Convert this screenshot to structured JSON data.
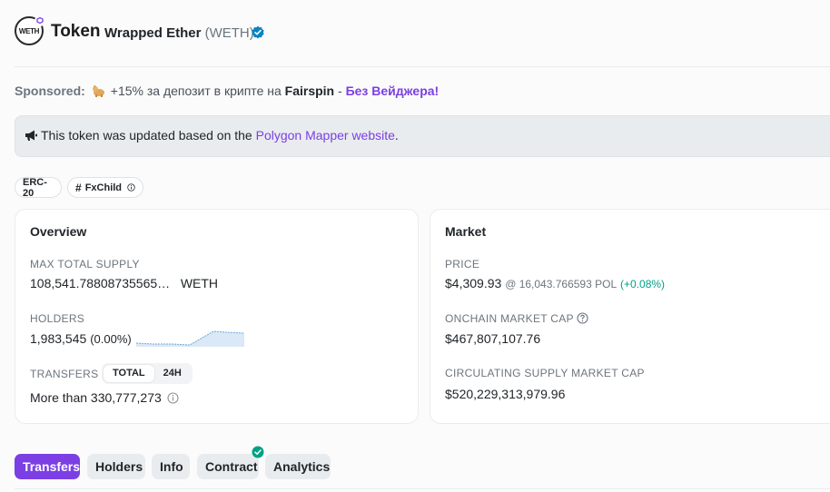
{
  "header": {
    "logo_text": "WETH",
    "title": "Token",
    "token_name": "Wrapped Ether",
    "token_symbol": "(WETH)"
  },
  "sponsored": {
    "label": "Sponsored:",
    "text": "+15% за депозит в крипте на ",
    "brand": "Fairspin",
    "sep": " - ",
    "cta": "Без Вейджера!"
  },
  "alert": {
    "text": "This token was updated based on the ",
    "link": "Polygon Mapper website",
    "end": "."
  },
  "tags": {
    "erc": "ERC-20",
    "fxchild": "FxChild"
  },
  "overview": {
    "title": "Overview",
    "max_supply_label": "MAX TOTAL SUPPLY",
    "max_supply_value": "108,541.78808735565…",
    "max_supply_unit": "WETH",
    "holders_label": "HOLDERS",
    "holders_value": "1,983,545",
    "holders_pct": "(0.00%)",
    "transfers_label": "TRANSFERS",
    "seg_total": "TOTAL",
    "seg_24h": "24H",
    "transfers_value": "More than 330,777,273"
  },
  "market": {
    "title": "Market",
    "price_label": "PRICE",
    "price_value": "$4,309.93",
    "price_pol": "@ 16,043.766593 POL",
    "price_change": "(+0.08%)",
    "onchain_label": "ONCHAIN MARKET CAP",
    "onchain_value": "$467,807,107.76",
    "circ_label": "CIRCULATING SUPPLY MARKET CAP",
    "circ_value": "$520,229,313,979.96"
  },
  "tabs": [
    "Transfers",
    "Holders",
    "Info",
    "Contract",
    "Analytics"
  ],
  "colors": {
    "accent": "#7b3fe4",
    "positive": "#00a186",
    "verified": "#0784c3"
  }
}
